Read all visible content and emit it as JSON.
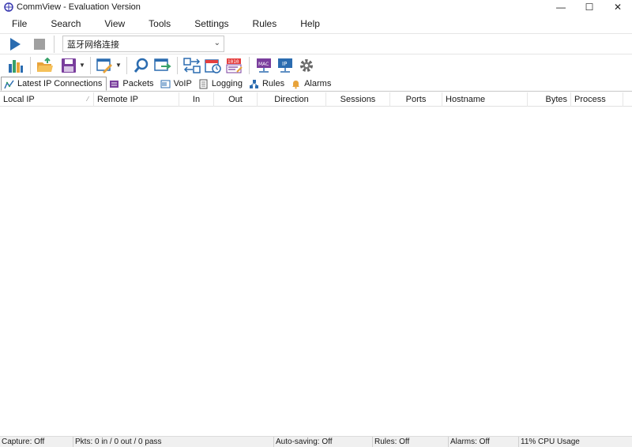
{
  "window": {
    "title": "CommView - Evaluation Version",
    "minimize": "—",
    "maximize": "☐",
    "close": "✕"
  },
  "menu": [
    "File",
    "Search",
    "View",
    "Tools",
    "Settings",
    "Rules",
    "Help"
  ],
  "capture": {
    "adapter": "蓝牙网络连接"
  },
  "tabs": [
    {
      "label": "Latest IP Connections",
      "icon": "connections-icon",
      "active": true
    },
    {
      "label": "Packets",
      "icon": "packets-icon"
    },
    {
      "label": "VoIP",
      "icon": "voip-icon"
    },
    {
      "label": "Logging",
      "icon": "logging-icon"
    },
    {
      "label": "Rules",
      "icon": "rules-icon"
    },
    {
      "label": "Alarms",
      "icon": "alarms-icon"
    }
  ],
  "table": {
    "columns": [
      "Local IP",
      "Remote IP",
      "In",
      "Out",
      "Direction",
      "Sessions",
      "Ports",
      "Hostname",
      "Bytes",
      "Process"
    ],
    "rows": []
  },
  "status": {
    "capture": "Capture: Off",
    "packets": "Pkts: 0 in / 0 out / 0 pass",
    "autosaving": "Auto-saving: Off",
    "rules": "Rules: Off",
    "alarms": "Alarms: Off",
    "cpu": "11% CPU Usage"
  },
  "colors": {
    "accent_blue": "#2b6cb0",
    "stop_gray": "#a0a0a0",
    "folder_orange": "#e8a33a",
    "save_purple": "#7a3e9d"
  }
}
